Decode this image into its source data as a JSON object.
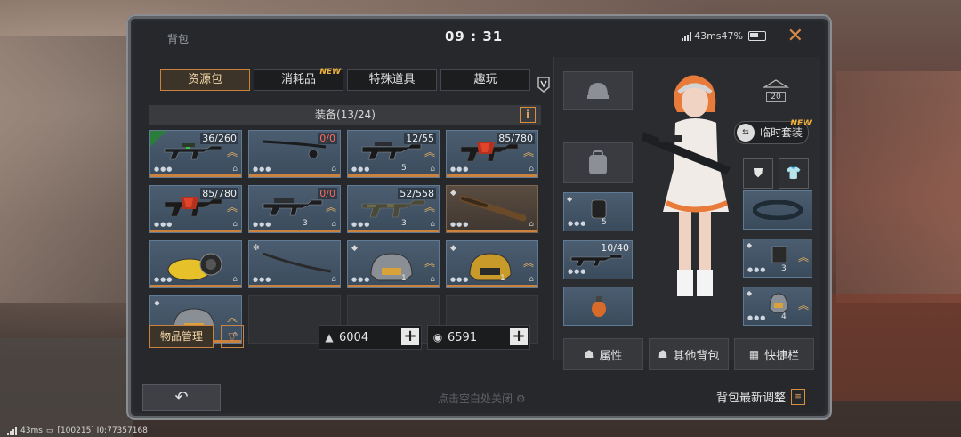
{
  "window": {
    "title": "背包",
    "clock": "09 : 31",
    "status_text": "43ms47%"
  },
  "tabs": [
    {
      "label": "资源包",
      "active": true,
      "new": false
    },
    {
      "label": "消耗品",
      "active": false,
      "new": true,
      "badge": "NEW"
    },
    {
      "label": "特殊道具",
      "active": false,
      "new": false
    },
    {
      "label": "趣玩",
      "active": false,
      "new": false
    }
  ],
  "equip_header": {
    "label": "装备(13/24)",
    "info_label": "i"
  },
  "inventory": [
    {
      "type": "rifle",
      "count": "36/260",
      "level": "",
      "style": "blue"
    },
    {
      "type": "fishing-rod",
      "count": "0/0",
      "level": "",
      "style": "blue"
    },
    {
      "type": "rifle",
      "count": "12/55",
      "level": "5",
      "style": "blue"
    },
    {
      "type": "red-rifle",
      "count": "85/780",
      "level": "",
      "style": "blue"
    },
    {
      "type": "red-rifle",
      "count": "85/780",
      "level": "",
      "style": "blue"
    },
    {
      "type": "rifle",
      "count": "0/0",
      "level": "3",
      "style": "blue"
    },
    {
      "type": "camo-rifle",
      "count": "52/558",
      "level": "3",
      "style": "blue"
    },
    {
      "type": "bat",
      "count": "",
      "level": "",
      "style": "bronze"
    },
    {
      "type": "yellow-gear",
      "count": "",
      "level": "",
      "style": "blue"
    },
    {
      "type": "katana",
      "count": "",
      "level": "",
      "style": "blue"
    },
    {
      "type": "helmet",
      "count": "",
      "level": "1",
      "style": "blue"
    },
    {
      "type": "gold-helmet",
      "count": "",
      "level": "1",
      "style": "blue"
    },
    {
      "type": "helmet",
      "count": "",
      "level": "3",
      "style": "blue"
    }
  ],
  "bottom_left": {
    "manage_label": "物品管理",
    "filter_icon": "filter-icon"
  },
  "currency": [
    {
      "icon": "gold-bars-icon",
      "value": "6004"
    },
    {
      "icon": "coin-icon",
      "value": "6591"
    }
  ],
  "character": {
    "level": "20",
    "temp_suit_label": "临时套装",
    "temp_suit_badge": "NEW",
    "side_slots": [
      {
        "name": "backpack-slot",
        "level": "5"
      },
      {
        "name": "weapon-slot",
        "count": "10/40"
      },
      {
        "name": "grenade-slot"
      }
    ],
    "right_slots": [
      {
        "name": "belt-slot"
      },
      {
        "name": "armor-slot",
        "level": "3"
      },
      {
        "name": "helmet-slot",
        "level": "4"
      }
    ]
  },
  "actions": [
    {
      "label": "属性",
      "icon": "person-icon"
    },
    {
      "label": "其他背包",
      "icon": "bag-icon"
    },
    {
      "label": "快捷栏",
      "icon": "grid-icon"
    }
  ],
  "footer": {
    "back_icon": "back-arrow-icon",
    "hint": "点击空白处关闭",
    "latest_label": "背包最新调整"
  },
  "system_bar": {
    "text": "43ms",
    "ids": "[100215] I0:77357168"
  },
  "colors": {
    "accent": "#c9833f",
    "new_badge": "#f0b33a",
    "cell_blue": "#4b5d70"
  }
}
